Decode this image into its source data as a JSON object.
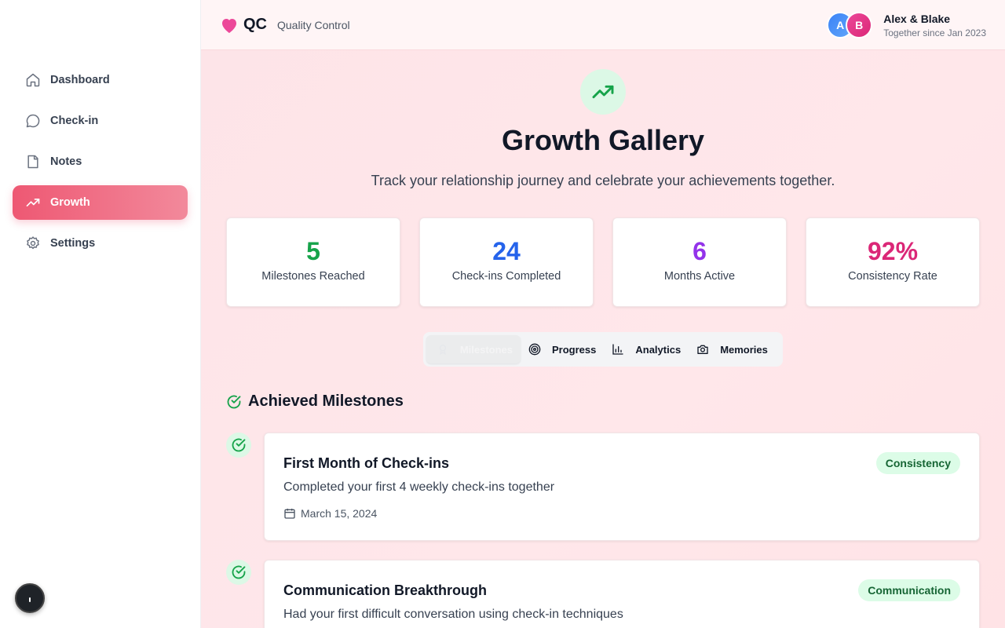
{
  "brand": {
    "logo": "QC",
    "tagline": "Quality Control"
  },
  "user": {
    "names": "Alex & Blake",
    "since": "Together since Jan 2023",
    "avatar_a": "A",
    "avatar_b": "B"
  },
  "sidebar": {
    "items": [
      {
        "label": "Dashboard",
        "icon": "home-icon"
      },
      {
        "label": "Check-in",
        "icon": "chat-bubble-icon"
      },
      {
        "label": "Notes",
        "icon": "document-icon"
      },
      {
        "label": "Growth",
        "icon": "trending-up-icon",
        "active": true
      },
      {
        "label": "Settings",
        "icon": "gear-icon"
      }
    ]
  },
  "page": {
    "title": "Growth Gallery",
    "subtitle": "Track your relationship journey and celebrate your achievements together."
  },
  "stats": [
    {
      "value": "5",
      "label": "Milestones Reached",
      "color": "#16a34a"
    },
    {
      "value": "24",
      "label": "Check-ins Completed",
      "color": "#2563eb"
    },
    {
      "value": "6",
      "label": "Months Active",
      "color": "#9333ea"
    },
    {
      "value": "92%",
      "label": "Consistency Rate",
      "color": "#db2777"
    }
  ],
  "tabs": [
    {
      "label": "Milestones",
      "icon": "award-icon",
      "active": true
    },
    {
      "label": "Progress",
      "icon": "target-icon"
    },
    {
      "label": "Analytics",
      "icon": "bar-chart-icon"
    },
    {
      "label": "Memories",
      "icon": "camera-icon"
    }
  ],
  "section": {
    "title": "Achieved Milestones"
  },
  "milestones": [
    {
      "title": "First Month of Check-ins",
      "description": "Completed your first 4 weekly check-ins together",
      "date": "March 15, 2024",
      "category": "Consistency"
    },
    {
      "title": "Communication Breakthrough",
      "description": "Had your first difficult conversation using check-in techniques",
      "date": "",
      "category": "Communication"
    }
  ],
  "colors": {
    "accent": "#ee5873",
    "success": "#16a34a"
  }
}
